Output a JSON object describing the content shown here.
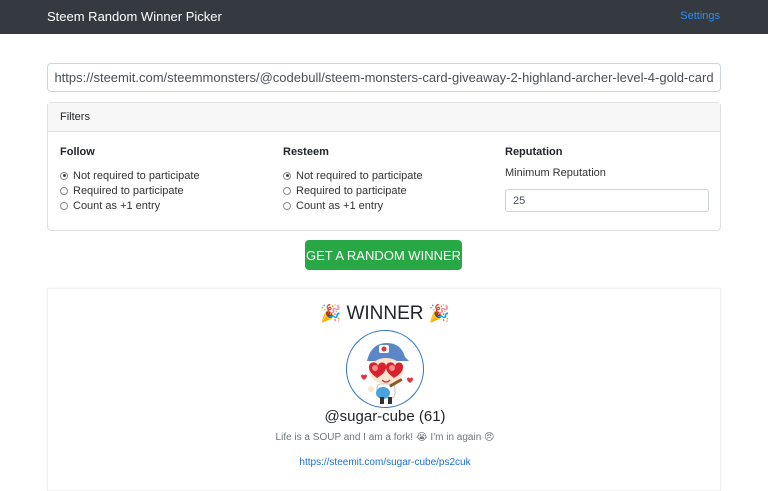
{
  "navbar": {
    "brand": "Steem Random Winner Picker",
    "settings_label": "Settings"
  },
  "url_input": {
    "value": "https://steemit.com/steemmonsters/@codebull/steem-monsters-card-giveaway-2-highland-archer-level-4-gold-card"
  },
  "filters": {
    "header": "Filters",
    "follow": {
      "title": "Follow",
      "options": [
        "Not required to participate",
        "Required to participate",
        "Count as +1 entry"
      ],
      "selected": 0
    },
    "resteem": {
      "title": "Resteem",
      "options": [
        "Not required to participate",
        "Required to participate",
        "Count as +1 entry"
      ],
      "selected": 0
    },
    "reputation": {
      "title": "Reputation",
      "label": "Minimum Reputation",
      "value": "25"
    }
  },
  "action": {
    "button_label": "GET A RANDOM WINNER"
  },
  "winner": {
    "heading": "WINNER",
    "party_icon": "party-popper-icon",
    "username": "@sugar-cube (61)",
    "bio": "Life is a SOUP and I am a fork! 😭 I'm in again 😠",
    "link": "https://steemit.com/sugar-cube/ps2cuk"
  },
  "colors": {
    "navbar": "#343a40",
    "accent_link": "#2d8cf5",
    "button_green": "#28a745",
    "avatar_border": "#2b73c6"
  }
}
